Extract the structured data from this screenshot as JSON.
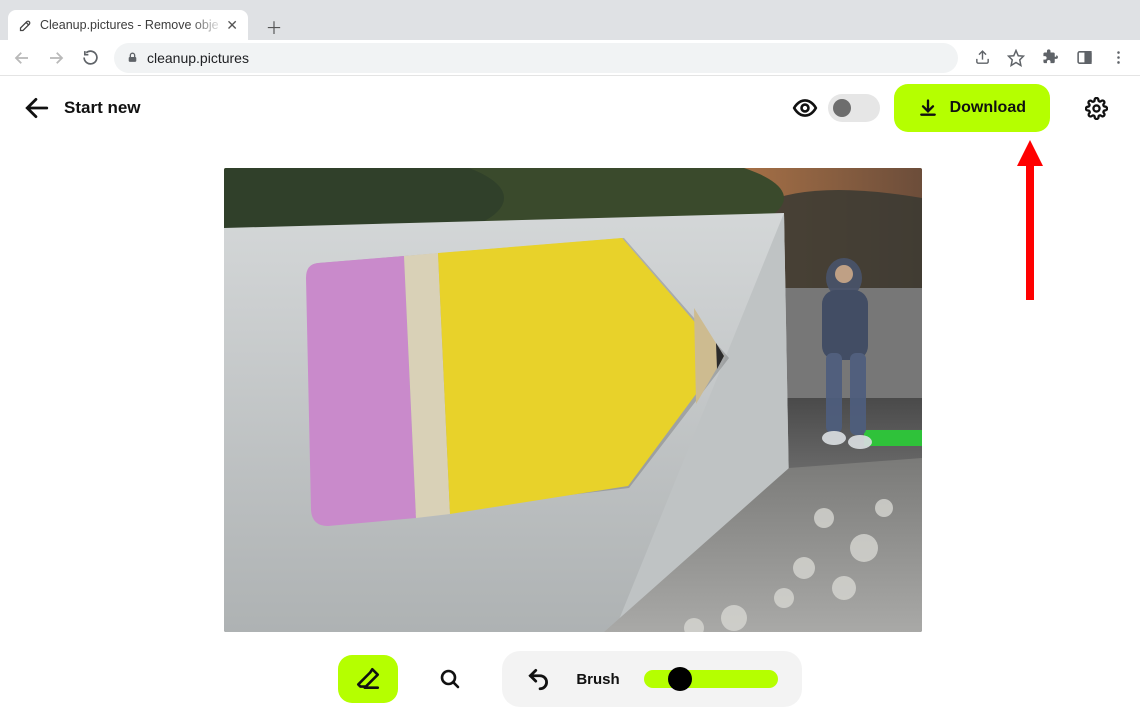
{
  "browser": {
    "tab_title": "Cleanup.pictures - Remove objects",
    "url": "cleanup.pictures"
  },
  "header": {
    "start_new_label": "Start new",
    "download_label": "Download"
  },
  "toolbar": {
    "brush_label": "Brush",
    "slider_pos_percent": 18
  },
  "colors": {
    "accent": "#b5ff00"
  },
  "annotation": {
    "arrow_target": "download-button"
  }
}
